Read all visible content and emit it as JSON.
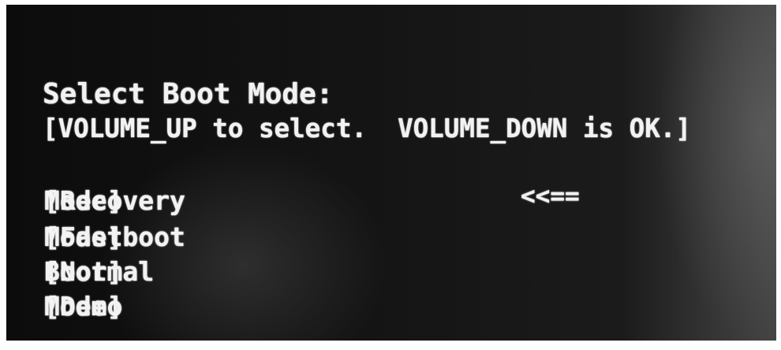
{
  "boot_menu": {
    "title": "Select Boot Mode:",
    "instructions": "[VOLUME_UP to select.  VOLUME_DOWN is OK.]",
    "selection_indicator": "<<==",
    "options": [
      {
        "left": "[Recovery",
        "right": "Mode]"
      },
      {
        "left": "[Fastboot",
        "right": "Mode]"
      },
      {
        "left": "[Normal",
        "right": "Boot]"
      },
      {
        "left": "[Demo",
        "right": "Mode]"
      }
    ],
    "selected_index": 0
  },
  "colors": {
    "screen_background": "#0c0c0c",
    "text": "#f2f2f2"
  }
}
